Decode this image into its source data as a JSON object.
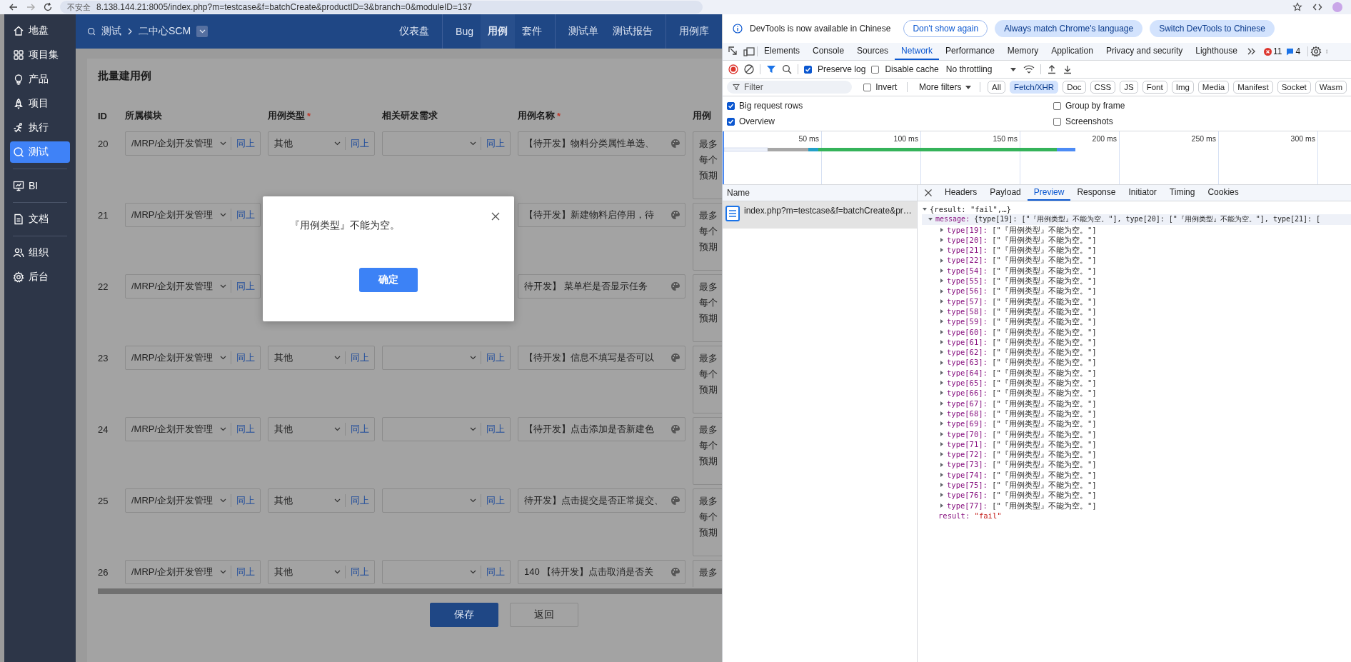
{
  "browser": {
    "security_label": "不安全",
    "url": "8.138.144.21:8005/index.php?m=testcase&f=batchCreate&productID=3&branch=0&moduleID=137"
  },
  "sidebar": {
    "groups": [
      [
        {
          "label": "地盘",
          "selected": false
        },
        {
          "label": "项目集",
          "selected": false
        },
        {
          "label": "产品",
          "selected": false
        },
        {
          "label": "项目",
          "selected": false
        },
        {
          "label": "执行",
          "selected": false
        },
        {
          "label": "测试",
          "selected": true
        }
      ],
      [
        {
          "label": "BI",
          "selected": false
        }
      ],
      [
        {
          "label": "文档",
          "selected": false
        }
      ],
      [
        {
          "label": "组织",
          "selected": false
        },
        {
          "label": "后台",
          "selected": false
        }
      ]
    ]
  },
  "header": {
    "breadcrumb": [
      "测试",
      "二中心SCM"
    ],
    "nav_groups": [
      [
        {
          "label": "仪表盘",
          "selected": false
        }
      ],
      [
        {
          "label": "Bug",
          "selected": false
        },
        {
          "label": "用例",
          "selected": true
        },
        {
          "label": "套件",
          "selected": false
        }
      ],
      [
        {
          "label": "测试单",
          "selected": false
        },
        {
          "label": "测试报告",
          "selected": false
        }
      ],
      [
        {
          "label": "用例库",
          "selected": false
        }
      ]
    ]
  },
  "form": {
    "title": "批量建用例",
    "columns": [
      {
        "label": "ID"
      },
      {
        "label": "所属模块"
      },
      {
        "label": "用例类型",
        "mark": "*"
      },
      {
        "label": "相关研发需求"
      },
      {
        "label": "用例名称",
        "mark": "*"
      },
      {
        "label": "用例"
      }
    ],
    "rows": [
      {
        "id": "20",
        "module": {
          "value": "/MRP/企划开发管理",
          "same": "同上"
        },
        "type": {
          "value": "其他",
          "same": "同上"
        },
        "requirement": {
          "same": "同上"
        },
        "name": "【待开发】物料分类属性单选、",
        "steps": [
          "最多",
          "每个",
          "预期"
        ]
      },
      {
        "id": "21",
        "module": {
          "value": "/MRP/企划开发管理",
          "same": "同上"
        },
        "name": "【待开发】新建物料启停用，待",
        "steps": [
          "最多",
          "每个",
          "预期"
        ]
      },
      {
        "id": "22",
        "module": {
          "value": "/MRP/企划开发管理",
          "same": "同上"
        },
        "name": "待开发】 菜单栏是否显示任务",
        "steps": [
          "最多",
          "每个",
          "预期"
        ]
      },
      {
        "id": "23",
        "module": {
          "value": "/MRP/企划开发管理",
          "same": "同上"
        },
        "type": {
          "value": "其他",
          "same": "同上"
        },
        "requirement": {
          "same": "同上"
        },
        "name": "【待开发】信息不填写是否可以",
        "steps": [
          "最多",
          "每个",
          "预期"
        ]
      },
      {
        "id": "24",
        "module": {
          "value": "/MRP/企划开发管理",
          "same": "同上"
        },
        "type": {
          "value": "其他",
          "same": "同上"
        },
        "requirement": {
          "same": "同上"
        },
        "name": "【待开发】点击添加是否新建色",
        "steps": [
          "最多",
          "每个",
          "预期"
        ]
      },
      {
        "id": "25",
        "module": {
          "value": "/MRP/企划开发管理",
          "same": "同上"
        },
        "type": {
          "value": "其他",
          "same": "同上"
        },
        "requirement": {
          "same": "同上"
        },
        "name": "待开发】点击提交是否正常提交、",
        "steps": [
          "最多",
          "每个",
          "预期"
        ]
      },
      {
        "id": "26",
        "module": {
          "value": "/MRP/企划开发管理",
          "same": "同上"
        },
        "type": {
          "value": "其他",
          "same": "同上"
        },
        "requirement": {
          "same": "同上"
        },
        "name": "140 【待开发】点击取消是否关",
        "steps": [
          "最多"
        ]
      }
    ],
    "buttons": [
      {
        "label": "保存",
        "kind": "primary"
      },
      {
        "label": "返回",
        "kind": "default"
      }
    ]
  },
  "dialog": {
    "message": "『用例类型』不能为空。",
    "ok_button": "确定"
  },
  "devtools": {
    "notice": {
      "text": "DevTools is now available in Chinese",
      "buttons": [
        {
          "label": "Don't show again",
          "kind": "outline"
        },
        {
          "label": "Always match Chrome's language",
          "kind": "filled"
        },
        {
          "label": "Switch DevTools to Chinese",
          "kind": "filled"
        }
      ]
    },
    "tabs": [
      {
        "label": "Elements",
        "selected": false
      },
      {
        "label": "Console",
        "selected": false
      },
      {
        "label": "Sources",
        "selected": false
      },
      {
        "label": "Network",
        "selected": true
      },
      {
        "label": "Performance",
        "selected": false
      },
      {
        "label": "Memory",
        "selected": false
      },
      {
        "label": "Application",
        "selected": false
      },
      {
        "label": "Privacy and security",
        "selected": false
      },
      {
        "label": "Lighthouse",
        "selected": false
      }
    ],
    "errors": "11",
    "messages": "4",
    "toolbar": {
      "checks": [
        {
          "label": "Preserve log",
          "checked": true
        },
        {
          "label": "Disable cache",
          "checked": false
        }
      ],
      "throttling": "No throttling"
    },
    "filter": {
      "placeholder": "Filter",
      "invert": {
        "label": "Invert",
        "checked": false
      },
      "more_filters": "More filters",
      "types": [
        {
          "label": "All",
          "selected": false
        },
        {
          "label": "Fetch/XHR",
          "selected": true
        },
        {
          "label": "Doc",
          "selected": false
        },
        {
          "label": "CSS",
          "selected": false
        },
        {
          "label": "JS",
          "selected": false
        },
        {
          "label": "Font",
          "selected": false
        },
        {
          "label": "Img",
          "selected": false
        },
        {
          "label": "Media",
          "selected": false
        },
        {
          "label": "Manifest",
          "selected": false
        },
        {
          "label": "Socket",
          "selected": false
        },
        {
          "label": "Wasm",
          "selected": false
        }
      ]
    },
    "options": [
      {
        "label": "Big request rows",
        "checked": true
      },
      {
        "label": "Group by frame",
        "checked": false
      },
      {
        "label": "Overview",
        "checked": true
      },
      {
        "label": "Screenshots",
        "checked": false
      }
    ],
    "timeline_ticks": [
      "50 ms",
      "100 ms",
      "150 ms",
      "200 ms",
      "250 ms",
      "300 ms"
    ],
    "requests": {
      "header": "Name",
      "items": [
        {
          "name": "index.php?m=testcase&f=batchCreate&pr…",
          "selected": true
        }
      ]
    },
    "detail_tabs": [
      {
        "label": "Headers",
        "selected": false
      },
      {
        "label": "Payload",
        "selected": false
      },
      {
        "label": "Preview",
        "selected": true
      },
      {
        "label": "Response",
        "selected": false
      },
      {
        "label": "Initiator",
        "selected": false
      },
      {
        "label": "Timing",
        "selected": false
      },
      {
        "label": "Cookies",
        "selected": false
      }
    ],
    "preview": {
      "root": {
        "summary": "{result: \"fail\",…}",
        "expanded": true
      },
      "message": {
        "key": "message:",
        "summary": "{type[19]: [\"『用例类型』不能为空。\"], type[20]: [\"『用例类型』不能为空。\"], type[21]: [",
        "expanded": true
      },
      "entries": [
        {
          "key": "type[19]:",
          "value": "[\"『用例类型』不能为空。\"]",
          "expanded": false
        },
        {
          "key": "type[20]:",
          "value": "[\"『用例类型』不能为空。\"]",
          "expanded": false
        },
        {
          "key": "type[21]:",
          "value": "[\"『用例类型』不能为空。\"]",
          "expanded": false
        },
        {
          "key": "type[22]:",
          "value": "[\"『用例类型』不能为空。\"]",
          "expanded": false
        },
        {
          "key": "type[54]:",
          "value": "[\"『用例类型』不能为空。\"]",
          "expanded": false
        },
        {
          "key": "type[55]:",
          "value": "[\"『用例类型』不能为空。\"]",
          "expanded": false
        },
        {
          "key": "type[56]:",
          "value": "[\"『用例类型』不能为空。\"]",
          "expanded": false
        },
        {
          "key": "type[57]:",
          "value": "[\"『用例类型』不能为空。\"]",
          "expanded": false
        },
        {
          "key": "type[58]:",
          "value": "[\"『用例类型』不能为空。\"]",
          "expanded": false
        },
        {
          "key": "type[59]:",
          "value": "[\"『用例类型』不能为空。\"]",
          "expanded": false
        },
        {
          "key": "type[60]:",
          "value": "[\"『用例类型』不能为空。\"]",
          "expanded": false
        },
        {
          "key": "type[61]:",
          "value": "[\"『用例类型』不能为空。\"]",
          "expanded": false
        },
        {
          "key": "type[62]:",
          "value": "[\"『用例类型』不能为空。\"]",
          "expanded": false
        },
        {
          "key": "type[63]:",
          "value": "[\"『用例类型』不能为空。\"]",
          "expanded": false
        },
        {
          "key": "type[64]:",
          "value": "[\"『用例类型』不能为空。\"]",
          "expanded": false
        },
        {
          "key": "type[65]:",
          "value": "[\"『用例类型』不能为空。\"]",
          "expanded": false
        },
        {
          "key": "type[66]:",
          "value": "[\"『用例类型』不能为空。\"]",
          "expanded": false
        },
        {
          "key": "type[67]:",
          "value": "[\"『用例类型』不能为空。\"]",
          "expanded": false
        },
        {
          "key": "type[68]:",
          "value": "[\"『用例类型』不能为空。\"]",
          "expanded": false
        },
        {
          "key": "type[69]:",
          "value": "[\"『用例类型』不能为空。\"]",
          "expanded": false
        },
        {
          "key": "type[70]:",
          "value": "[\"『用例类型』不能为空。\"]",
          "expanded": false
        },
        {
          "key": "type[71]:",
          "value": "[\"『用例类型』不能为空。\"]",
          "expanded": false
        },
        {
          "key": "type[72]:",
          "value": "[\"『用例类型』不能为空。\"]",
          "expanded": false
        },
        {
          "key": "type[73]:",
          "value": "[\"『用例类型』不能为空。\"]",
          "expanded": false
        },
        {
          "key": "type[74]:",
          "value": "[\"『用例类型』不能为空。\"]",
          "expanded": false
        },
        {
          "key": "type[75]:",
          "value": "[\"『用例类型』不能为空。\"]",
          "expanded": false
        },
        {
          "key": "type[76]:",
          "value": "[\"『用例类型』不能为空。\"]",
          "expanded": false
        },
        {
          "key": "type[77]:",
          "value": "[\"『用例类型』不能为空。\"]",
          "expanded": false
        }
      ],
      "result": {
        "key": "result:",
        "value": "\"fail\""
      }
    }
  }
}
